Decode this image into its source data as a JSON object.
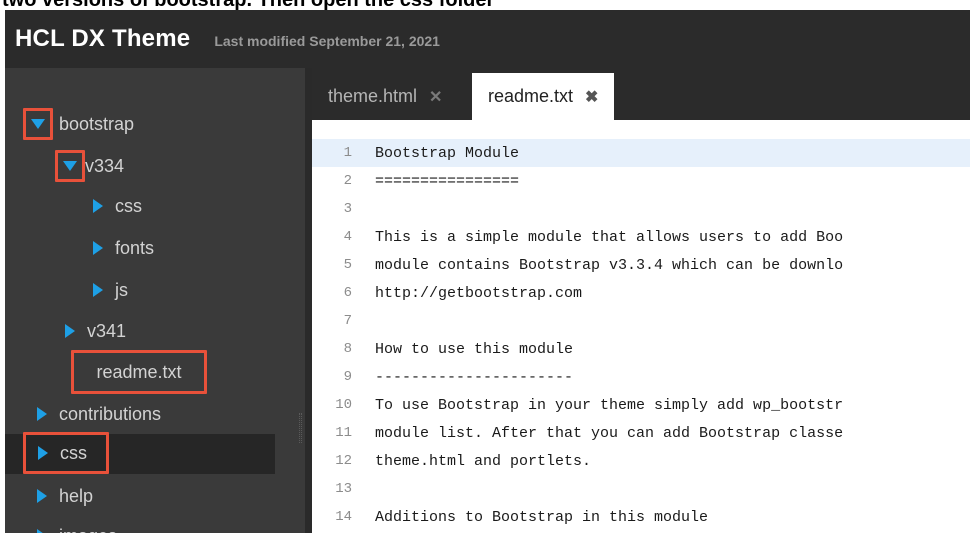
{
  "caption": "two versions of bootstrap. Then open the css folder",
  "header": {
    "title": "HCL DX Theme",
    "last_modified": "Last modified September 21, 2021"
  },
  "tree": {
    "bootstrap": "bootstrap",
    "v334": "v334",
    "css_sub": "css",
    "fonts": "fonts",
    "js": "js",
    "v341": "v341",
    "readme": "readme.txt",
    "contributions": "contributions",
    "css": "css",
    "help": "help",
    "images": "images"
  },
  "tabs": [
    {
      "label": "theme.html",
      "close": "✕"
    },
    {
      "label": "readme.txt",
      "close": "✖"
    }
  ],
  "lines": [
    {
      "n": "1",
      "text": "Bootstrap Module"
    },
    {
      "n": "2",
      "text": "================"
    },
    {
      "n": "3",
      "text": ""
    },
    {
      "n": "4",
      "text": "This is a simple module that allows users to add Boo"
    },
    {
      "n": "5",
      "text": "module contains Bootstrap v3.3.4 which can be downlo"
    },
    {
      "n": "6",
      "text": "http://getbootstrap.com"
    },
    {
      "n": "7",
      "text": ""
    },
    {
      "n": "8",
      "text": "How to use this module"
    },
    {
      "n": "9",
      "text": "----------------------"
    },
    {
      "n": "10",
      "text": "To use Bootstrap in your theme simply add wp_bootstr"
    },
    {
      "n": "11",
      "text": "module list. After that you can add Bootstrap classe"
    },
    {
      "n": "12",
      "text": "theme.html and portlets."
    },
    {
      "n": "13",
      "text": ""
    },
    {
      "n": "14",
      "text": "Additions to Bootstrap in this module"
    }
  ],
  "colors": {
    "accent": "#1ea0e6",
    "highlight_box": "#e8513a",
    "sidebar_bg": "#3a3a3a",
    "header_bg": "#2b2b2b"
  }
}
